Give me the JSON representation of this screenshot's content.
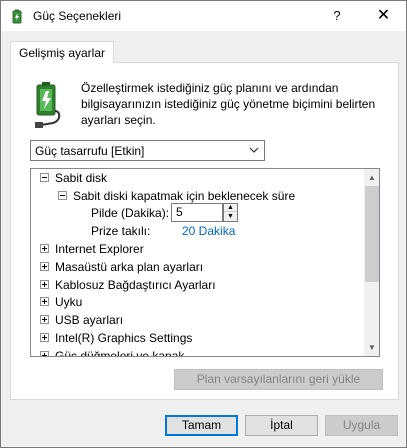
{
  "window": {
    "title": "Güç Seçenekleri",
    "help_label": "?",
    "close_label": "✕"
  },
  "tab": {
    "label": "Gelişmiş ayarlar"
  },
  "description": "Özelleştirmek istediğiniz güç planını ve ardından bilgisayarınızın istediğiniz güç yönetme biçimini belirten ayarları seçin.",
  "plan": {
    "selected": "Güç tasarrufu [Etkin]"
  },
  "tree": {
    "items": [
      {
        "label": "Sabit disk",
        "expanded": true
      },
      {
        "label": "Sabit diski kapatmak için beklenecek süre",
        "expanded": true
      },
      {
        "label": "Pilde (Dakika):",
        "value": "5"
      },
      {
        "label": "Prize takılı:",
        "value": "20 Dakika"
      },
      {
        "label": "Internet Explorer",
        "expanded": false
      },
      {
        "label": "Masaüstü arka plan ayarları",
        "expanded": false
      },
      {
        "label": "Kablosuz Bağdaştırıcı Ayarları",
        "expanded": false
      },
      {
        "label": "Uyku",
        "expanded": false
      },
      {
        "label": "USB ayarları",
        "expanded": false
      },
      {
        "label": "Intel(R) Graphics Settings",
        "expanded": false
      },
      {
        "label": "Güç düğmeleri ve kapak",
        "expanded": false
      }
    ]
  },
  "buttons": {
    "restore": "Plan varsayılanlarını geri yükle",
    "ok": "Tamam",
    "cancel": "İptal",
    "apply": "Uygula"
  },
  "colors": {
    "link": "#0066cc",
    "accent": "#0078d7"
  }
}
